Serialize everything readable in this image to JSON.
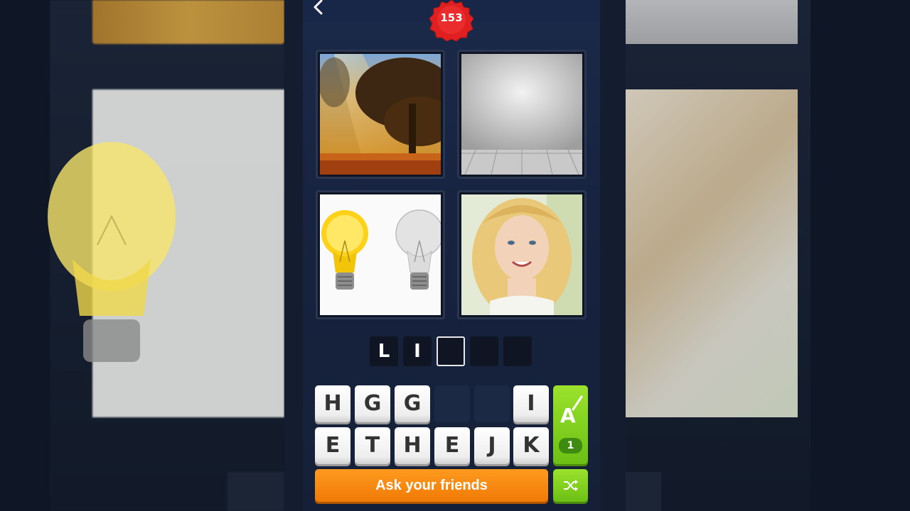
{
  "level": {
    "number": "153"
  },
  "answer": {
    "slots": [
      "L",
      "I",
      "",
      "",
      ""
    ]
  },
  "keyboard": {
    "row1": [
      "H",
      "G",
      "G",
      "",
      "",
      "I"
    ],
    "row2": [
      "E",
      "T",
      "H",
      "E",
      "J",
      "K"
    ]
  },
  "hint": {
    "count": "1"
  },
  "actions": {
    "ask_label": "Ask your friends"
  },
  "icons": {
    "back": "chevron-left-icon",
    "hint": "letter-reveal-icon",
    "shuffle": "shuffle-icon"
  },
  "colors": {
    "badge": "#e02020",
    "ask_button": "#f58a10",
    "green_button": "#7ccc1a",
    "panel": "#1b2a49"
  }
}
